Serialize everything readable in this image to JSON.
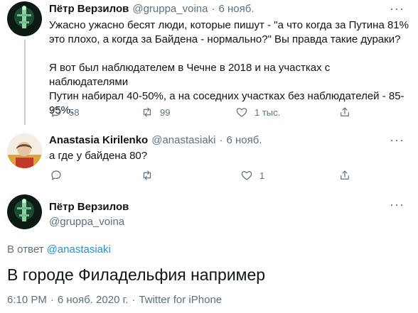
{
  "tweet1": {
    "name": "Пётр Верзилов",
    "handle": "@gruppa_voina",
    "sep": "·",
    "date": "6 нояб.",
    "line1": "Ужасно ужасно бесят люди, которые пишут - \"а что когда за Путина 81%",
    "line2": "это плохо, а когда за Байдена - нормально?\" Вы правда такие дураки?",
    "line3": "Я вот был наблюдателем в Чечне в 2018 и на участках с наблюдателями",
    "line4": "Путин набирал 40-50%, а на соседних участках без наблюдателей - 85-",
    "line5": "95%.",
    "replies": "58",
    "retweets": "99",
    "likes": "1 тыс."
  },
  "tweet2": {
    "name": "Anastasia Kirilenko",
    "handle": "@anastasiaki",
    "sep": "·",
    "date": "6 нояб.",
    "text": "а где у байдена 80?",
    "likes": "1"
  },
  "main": {
    "name": "Пётр Верзилов",
    "handle": "@gruppa_voina",
    "reply_prefix": "В ответ",
    "reply_to": "@anastasiaki",
    "text": "В городе Филадельфия например",
    "time": "6:10 PM",
    "date": "6 нояб. 2020 г.",
    "source": "Twitter for iPhone",
    "sep": "·"
  },
  "colors": {
    "accent": "#1b95e0",
    "muted": "#5b7083"
  }
}
